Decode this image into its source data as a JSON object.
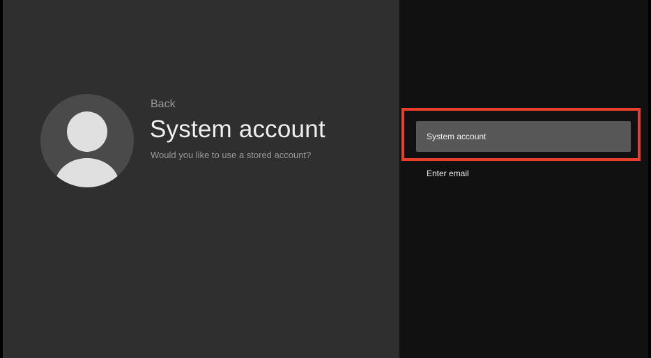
{
  "left": {
    "back_label": "Back",
    "title": "System account",
    "subtitle": "Would you like to use a stored account?",
    "avatar_icon": "person-icon"
  },
  "options": [
    {
      "label": "System account",
      "selected": true
    },
    {
      "label": "Enter email",
      "selected": false
    }
  ],
  "colors": {
    "left_panel_bg": "#2f2f2f",
    "right_panel_bg": "#111111",
    "selected_option_bg": "#575757",
    "highlight_frame": "#e8402a",
    "avatar_bg": "#4a4a4a",
    "avatar_figure": "#e0e0e0"
  }
}
